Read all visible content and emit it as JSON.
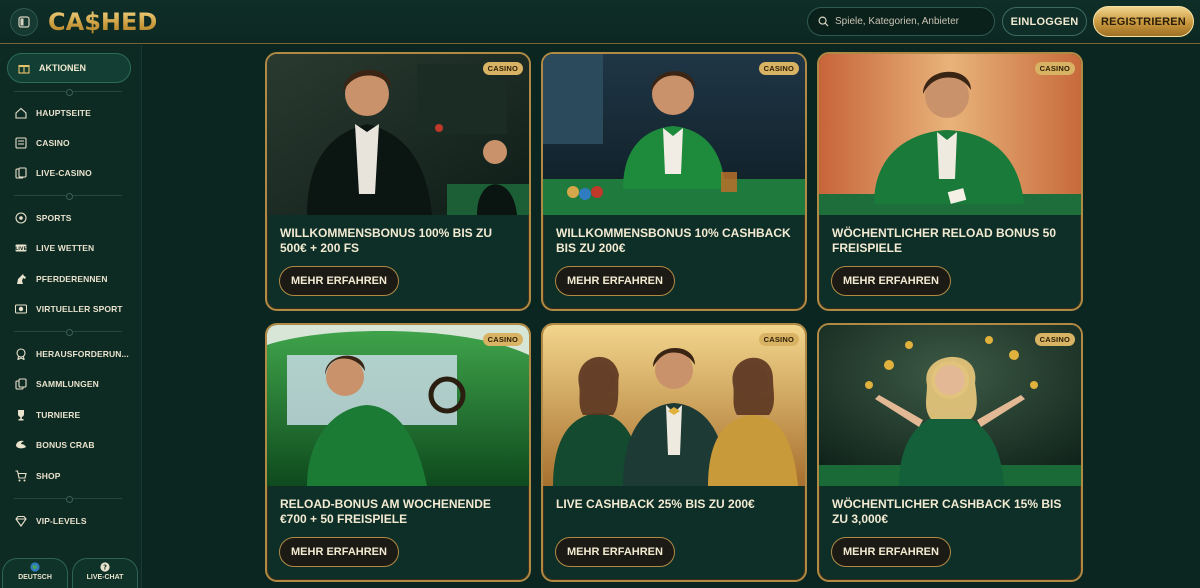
{
  "header": {
    "logo": "CA$HED",
    "search_placeholder": "Spiele, Kategorien, Anbieter",
    "login_label": "EINLOGGEN",
    "register_label": "REGISTRIEREN"
  },
  "sidebar": {
    "active_label": "AKTIONEN",
    "items": [
      {
        "label": "HAUPTSEITE",
        "icon": "home-icon"
      },
      {
        "label": "CASINO",
        "icon": "casino-icon"
      },
      {
        "label": "LIVE-CASINO",
        "icon": "live-casino-icon"
      },
      {
        "label": "SPORTS",
        "icon": "football-icon"
      },
      {
        "label": "LIVE WETTEN",
        "icon": "live-icon"
      },
      {
        "label": "PFERDERENNEN",
        "icon": "horse-icon"
      },
      {
        "label": "VIRTUELLER SPORT",
        "icon": "virtual-sport-icon"
      },
      {
        "label": "HERAUSFORDERUN...",
        "icon": "badge-icon"
      },
      {
        "label": "SAMMLUNGEN",
        "icon": "collections-icon"
      },
      {
        "label": "TURNIERE",
        "icon": "trophy-icon"
      },
      {
        "label": "BONUS CRAB",
        "icon": "crab-icon"
      },
      {
        "label": "SHOP",
        "icon": "cart-icon"
      },
      {
        "label": "VIP-LEVELS",
        "icon": "diamond-icon"
      }
    ],
    "language_label": "DEUTSCH",
    "chat_label": "LIVE-CHAT"
  },
  "cards": [
    {
      "badge": "CASINO",
      "title": "WILLKOMMENSBONUS 100% BIS ZU 500€ + 200 FS",
      "cta": "MEHR ERFAHREN"
    },
    {
      "badge": "CASINO",
      "title": "WILLKOMMENSBONUS 10% CASHBACK BIS ZU 200€",
      "cta": "MEHR ERFAHREN"
    },
    {
      "badge": "CASINO",
      "title": "WÖCHENTLICHER RELOAD BONUS 50 FREISPIELE",
      "cta": "MEHR ERFAHREN"
    },
    {
      "badge": "CASINO",
      "title": "RELOAD-BONUS AM WOCHENENDE €700 + 50 FREISPIELE",
      "cta": "MEHR ERFAHREN"
    },
    {
      "badge": "CASINO",
      "title": "LIVE CASHBACK 25% BIS ZU 200€",
      "cta": "MEHR ERFAHREN"
    },
    {
      "badge": "CASINO",
      "title": "WÖCHENTLICHER CASHBACK 15% BIS ZU 3,000€",
      "cta": "MEHR ERFAHREN"
    }
  ],
  "colors": {
    "background": "#0b2620",
    "gold": "#d9b364",
    "card": "#0e2f28",
    "text": "#f3ead2"
  }
}
